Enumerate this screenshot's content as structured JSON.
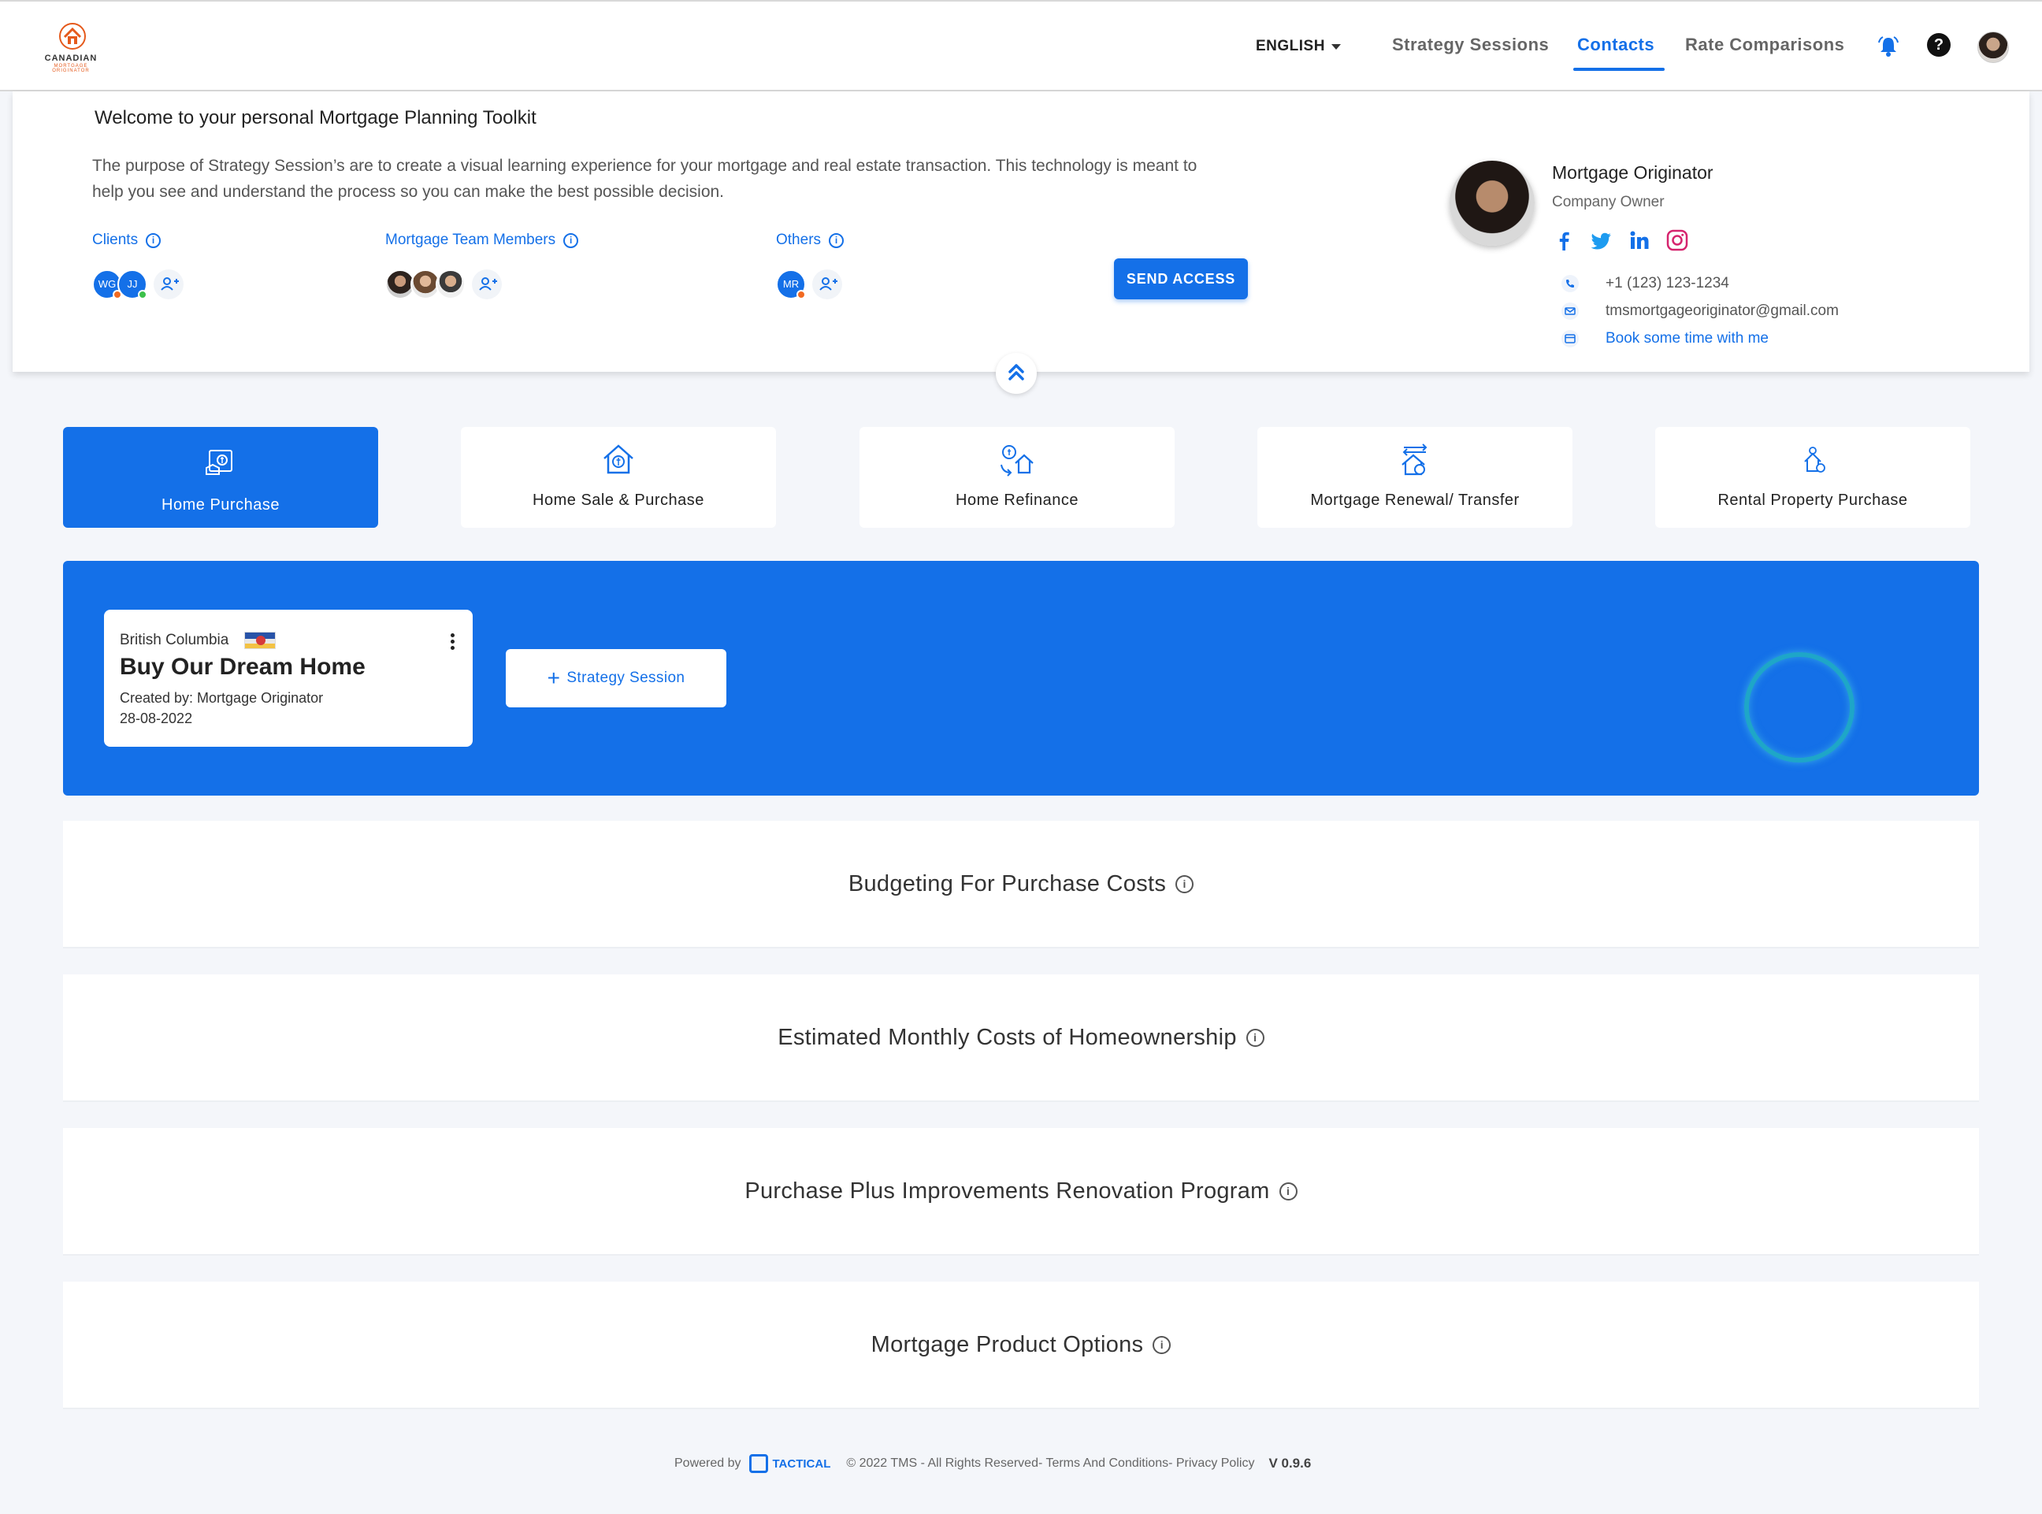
{
  "brand": {
    "name": "CANADIAN",
    "tagline": "MORTGAGE ORIGINATOR"
  },
  "nav": {
    "language": "ENGLISH",
    "links": [
      "Strategy Sessions",
      "Contacts",
      "Rate Comparisons"
    ],
    "active": "Contacts",
    "accent_color": "#1470e8"
  },
  "welcome": {
    "title": "Welcome to your personal Mortgage Planning Toolkit",
    "description": "The purpose of Strategy Session’s are to create a visual learning experience for your mortgage and real estate transaction. This technology is meant to help you see and understand the process so you can make the best possible decision.",
    "groups": {
      "clients": {
        "label": "Clients",
        "members": [
          "WG",
          "JJ"
        ]
      },
      "team": {
        "label": "Mortgage Team Members"
      },
      "others": {
        "label": "Others",
        "members": [
          "MR"
        ]
      }
    },
    "send_access": "SEND ACCESS"
  },
  "originator": {
    "name": "Mortgage Originator",
    "role": "Company Owner",
    "phone": "+1 (123) 123-1234",
    "email": "tmsmortgageoriginator@gmail.com",
    "booking": "Book some time with me",
    "socials": [
      "facebook-icon",
      "twitter-icon",
      "linkedin-icon",
      "instagram-icon"
    ]
  },
  "categories": [
    {
      "label": "Home Purchase",
      "icon": "home-purchase-icon",
      "active": true
    },
    {
      "label": "Home Sale & Purchase",
      "icon": "home-sale-icon"
    },
    {
      "label": "Home Refinance",
      "icon": "home-refinance-icon"
    },
    {
      "label": "Mortgage Renewal/ Transfer",
      "icon": "mortgage-renewal-icon"
    },
    {
      "label": "Rental Property Purchase",
      "icon": "rental-property-icon"
    }
  ],
  "plan": {
    "region": "British Columbia",
    "title": "Buy Our Dream Home",
    "created_by": "Created by: Mortgage Originator",
    "date": "28-08-2022",
    "add_session": "Strategy Session"
  },
  "sections": [
    "Budgeting For Purchase Costs",
    "Estimated Monthly Costs of Homeownership",
    "Purchase Plus Improvements Renovation Program",
    "Mortgage Product Options"
  ],
  "footer": {
    "powered_by": "Powered by",
    "company": "TACTICAL",
    "rights": "© 2022 TMS - All Rights Reserved- Terms And Conditions- Privacy Policy",
    "version": "V 0.9.6"
  }
}
